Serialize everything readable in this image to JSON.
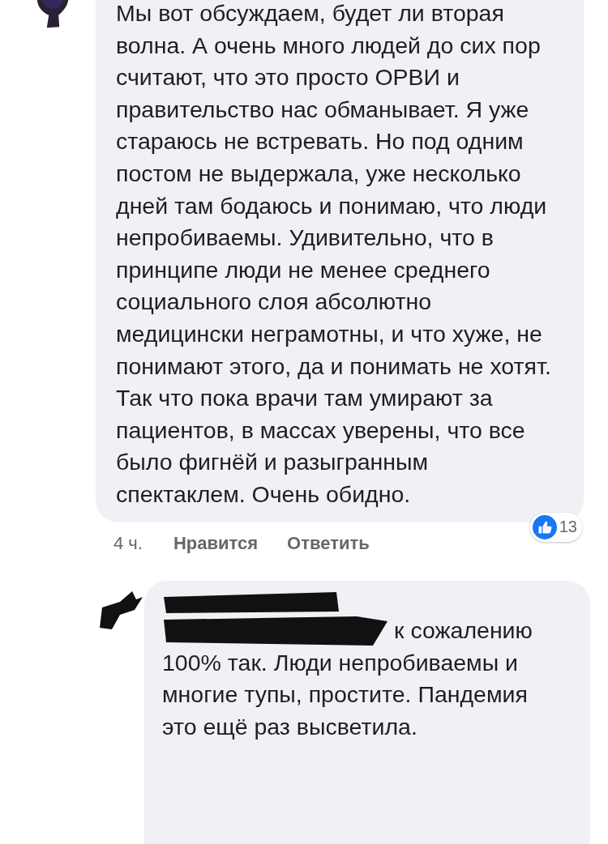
{
  "comment": {
    "text": "Мы вот обсуждаем, будет ли вторая волна. А очень много людей до сих пор считают, что это просто ОРВИ и правительство нас обманывает. Я уже стараюсь не встревать. Но под одним постом не выдержала, уже несколько дней там бодаюсь и понимаю, что люди непробиваемы. Удивительно, что в принципе люди не менее среднего социального слоя абсолютно медицински неграмотны, и что хуже, не понимают этого, да и понимать не хотят. Так что пока врачи там умирают за пациентов, в массах уверены, что все было фигнёй и разыгранным спектаклем. Очень обидно.",
    "time": "4 ч.",
    "actions": [
      "Нравится",
      "Ответить"
    ],
    "reaction_count": "13"
  },
  "reply": {
    "first_line": "к сожалению",
    "text": "100% так. Люди непробиваемы и многие тупы, простите. Пандемия это ещё раз высветила."
  }
}
